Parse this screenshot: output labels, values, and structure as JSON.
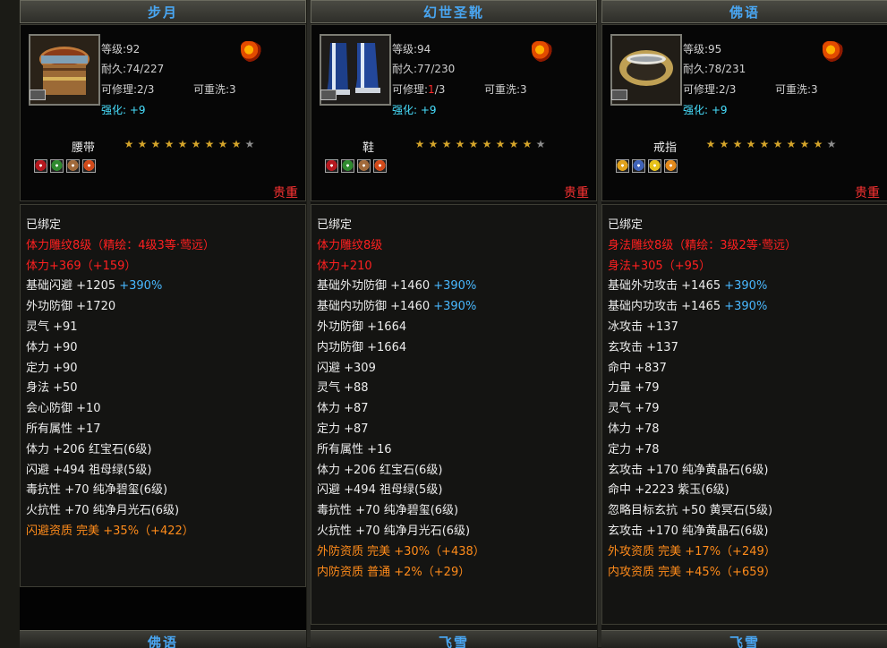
{
  "cards": [
    {
      "title": "步月",
      "level": "等级:92",
      "durability": "耐久:74/227",
      "repairable": "可修理:2/3",
      "rewashable": "可重洗:3",
      "enhance": "强化: +9",
      "slot": "腰带",
      "stars": 9,
      "max_stars": 10,
      "gem_colors": [
        "#b7181f",
        "#2f8a2f",
        "#a16a3b",
        "#d24a1a"
      ],
      "rarity": "贵重",
      "attributes": [
        {
          "text": "已绑定",
          "style": "white"
        },
        {
          "text": "体力雕纹8级（精绘：4级3等·莺远）",
          "style": "red"
        },
        {
          "text": "体力+369（+159）",
          "style": "red"
        },
        {
          "text": "基础闪避 +1205 +390%",
          "style": "white"
        },
        {
          "text": "外功防御 +1720",
          "style": "white"
        },
        {
          "text": "灵气 +91",
          "style": "white"
        },
        {
          "text": "体力 +90",
          "style": "white"
        },
        {
          "text": "定力 +90",
          "style": "white"
        },
        {
          "text": "身法 +50",
          "style": "white"
        },
        {
          "text": "会心防御 +10",
          "style": "white"
        },
        {
          "text": "所有属性 +17",
          "style": "white"
        },
        {
          "text": "体力 +206 红宝石(6级)",
          "style": "white"
        },
        {
          "text": "闪避 +494 祖母绿(5级)",
          "style": "white"
        },
        {
          "text": "毒抗性 +70 纯净碧玺(6级)",
          "style": "white"
        },
        {
          "text": "火抗性 +70 纯净月光石(6级)",
          "style": "white"
        },
        {
          "text": "闪避资质  完美 +35%（+422）",
          "style": "orange"
        }
      ],
      "next_title": "佛语"
    },
    {
      "title": "幻世圣靴",
      "level": "等级:94",
      "durability": "耐久:77/230",
      "repairable_prefix": "可修理:",
      "repairable_value": "1",
      "repairable_suffix": "/3",
      "rewashable": "可重洗:3",
      "enhance": "强化: +9",
      "slot": "鞋",
      "stars": 9,
      "max_stars": 10,
      "gem_colors": [
        "#b7181f",
        "#2f8a2f",
        "#a16a3b",
        "#d24a1a"
      ],
      "rarity": "贵重",
      "attributes": [
        {
          "text": "已绑定",
          "style": "white"
        },
        {
          "text": "体力雕纹8级",
          "style": "red"
        },
        {
          "text": "体力+210",
          "style": "red"
        },
        {
          "text": "基础外功防御 +1460 +390%",
          "style": "white"
        },
        {
          "text": "基础内功防御 +1460 +390%",
          "style": "white"
        },
        {
          "text": "外功防御 +1664",
          "style": "white"
        },
        {
          "text": "内功防御 +1664",
          "style": "white"
        },
        {
          "text": "闪避 +309",
          "style": "white"
        },
        {
          "text": "灵气 +88",
          "style": "white"
        },
        {
          "text": "体力 +87",
          "style": "white"
        },
        {
          "text": "定力 +87",
          "style": "white"
        },
        {
          "text": "所有属性 +16",
          "style": "white"
        },
        {
          "text": "体力 +206 红宝石(6级)",
          "style": "white"
        },
        {
          "text": "闪避 +494 祖母绿(5级)",
          "style": "white"
        },
        {
          "text": "毒抗性 +70 纯净碧玺(6级)",
          "style": "white"
        },
        {
          "text": "火抗性 +70 纯净月光石(6级)",
          "style": "white"
        },
        {
          "text": "外防资质  完美 +30%（+438）",
          "style": "orange"
        },
        {
          "text": "内防资质  普通 +2%（+29）",
          "style": "orange"
        }
      ],
      "next_title": "飞雪"
    },
    {
      "title": "佛语",
      "level": "等级:95",
      "durability": "耐久:78/231",
      "repairable": "可修理:2/3",
      "rewashable": "可重洗:3",
      "enhance": "强化: +9",
      "slot": "戒指",
      "stars": 9,
      "max_stars": 10,
      "gem_colors": [
        "#e1a21c",
        "#4063b8",
        "#e6c21a",
        "#e48a1c"
      ],
      "rarity": "贵重",
      "attributes": [
        {
          "text": "已绑定",
          "style": "white"
        },
        {
          "text": "身法雕纹8级（精绘：3级2等·莺远）",
          "style": "red"
        },
        {
          "text": "身法+305（+95）",
          "style": "red"
        },
        {
          "text": "基础外功攻击 +1465 +390%",
          "style": "white"
        },
        {
          "text": "基础内功攻击 +1465 +390%",
          "style": "white"
        },
        {
          "text": "冰攻击 +137",
          "style": "white"
        },
        {
          "text": "玄攻击 +137",
          "style": "white"
        },
        {
          "text": "命中 +837",
          "style": "white"
        },
        {
          "text": "力量 +79",
          "style": "white"
        },
        {
          "text": "灵气 +79",
          "style": "white"
        },
        {
          "text": "体力 +78",
          "style": "white"
        },
        {
          "text": "定力 +78",
          "style": "white"
        },
        {
          "text": "玄攻击 +170 纯净黄晶石(6级)",
          "style": "white"
        },
        {
          "text": "命中 +2223 紫玉(6级)",
          "style": "white"
        },
        {
          "text": "忽略目标玄抗 +50 黄冥石(5级)",
          "style": "white"
        },
        {
          "text": "玄攻击 +170 纯净黄晶石(6级)",
          "style": "white"
        },
        {
          "text": "外攻资质  完美 +17%（+249）",
          "style": "orange"
        },
        {
          "text": "内攻资质  完美 +45%（+659）",
          "style": "orange"
        }
      ],
      "next_title": "飞雪"
    }
  ]
}
